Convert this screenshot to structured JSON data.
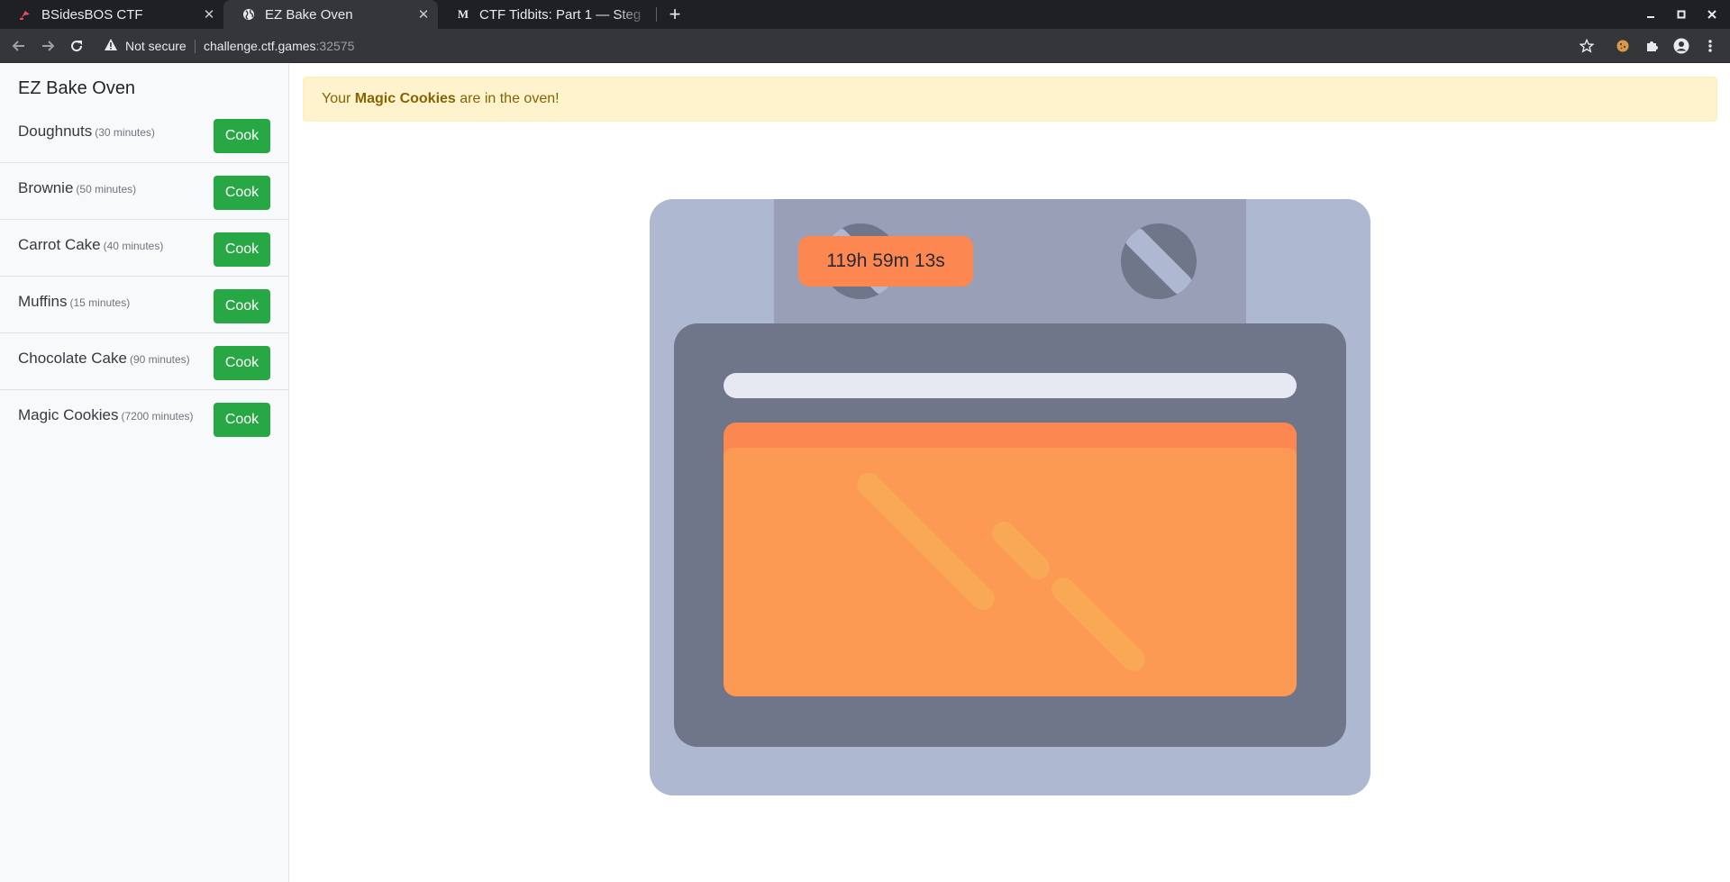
{
  "browser": {
    "tabs": [
      {
        "title": "BSidesBOS CTF",
        "favicon": "ctf-flag-icon",
        "active": false
      },
      {
        "title": "EZ Bake Oven",
        "favicon": "globe-icon",
        "active": true
      },
      {
        "title": "CTF Tidbits: Part 1 — Steg",
        "favicon": "medium-m-icon",
        "active": false
      }
    ],
    "new_tab_icon": "plus-icon",
    "security_label": "Not secure",
    "url_host": "challenge.ctf.games",
    "url_port": ":32575",
    "icons": [
      "back-arrow-icon",
      "forward-arrow-icon",
      "reload-icon",
      "warning-triangle-icon",
      "star-bookmark-icon",
      "cookie-extension-icon",
      "puzzle-extensions-icon",
      "profile-icon",
      "kebab-menu-icon",
      "minimize-icon",
      "maximize-icon",
      "close-window-icon"
    ]
  },
  "sidebar": {
    "brand": "EZ Bake Oven",
    "items": [
      {
        "name": "Doughnuts",
        "minutes": "(30 minutes)",
        "button": "Cook"
      },
      {
        "name": "Brownie",
        "minutes": "(50 minutes)",
        "button": "Cook"
      },
      {
        "name": "Carrot Cake",
        "minutes": "(40 minutes)",
        "button": "Cook"
      },
      {
        "name": "Muffins",
        "minutes": "(15 minutes)",
        "button": "Cook"
      },
      {
        "name": "Chocolate Cake",
        "minutes": "(90 minutes)",
        "button": "Cook"
      },
      {
        "name": "Magic Cookies",
        "minutes": "(7200 minutes)",
        "button": "Cook"
      }
    ]
  },
  "alert": {
    "prefix": "Your ",
    "item": "Magic Cookies",
    "suffix": " are in the oven!"
  },
  "oven": {
    "timer": "119h 59m 13s"
  },
  "colors": {
    "cook_button": "#28a745",
    "alert_bg": "#fff3cd",
    "alert_text": "#856404",
    "oven_body": "#aeb8d1",
    "oven_door": "#707689",
    "oven_glow": "#fd8750"
  }
}
